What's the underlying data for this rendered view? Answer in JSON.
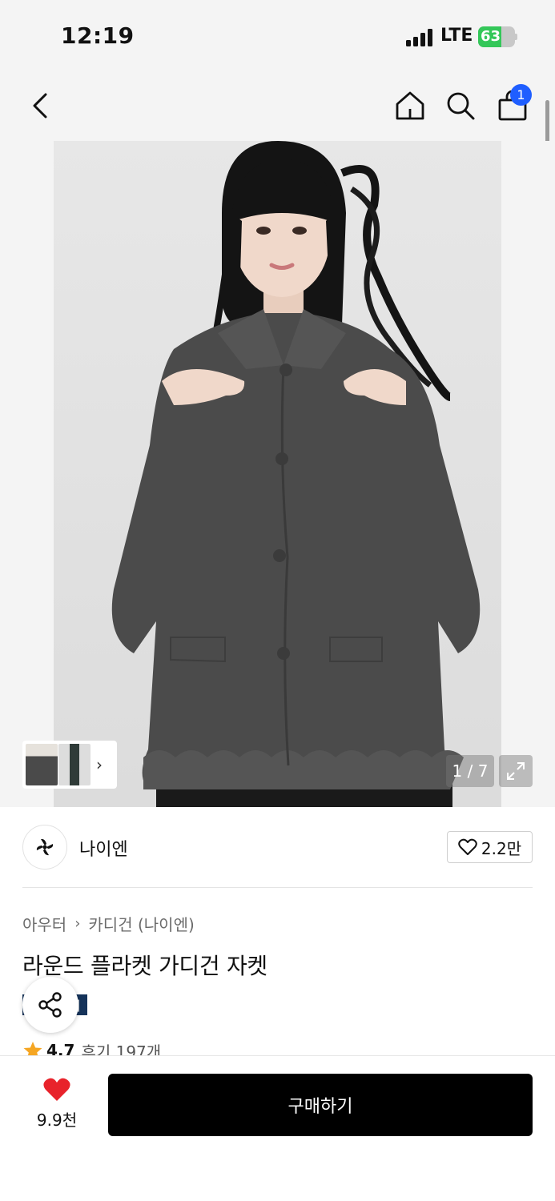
{
  "status_bar": {
    "time": "12:19",
    "network": "LTE",
    "battery": "63",
    "battery_level": 0.63
  },
  "nav": {
    "back_icon": "chevron-left-icon",
    "home_icon": "home-icon",
    "search_icon": "search-icon",
    "cart_icon": "shopping-bag-icon",
    "cart_count": "1"
  },
  "gallery": {
    "page_counter": "1 / 7",
    "expand_icon": "expand-icon",
    "thumb_arrow": "›"
  },
  "brand": {
    "name": "나이엔",
    "like_count": "2.2만"
  },
  "breadcrumb": {
    "category": "아우터",
    "separator": "›",
    "subcategory": "카디건 (나이엔)"
  },
  "product": {
    "title": "라운드 플라켓 가디건 자켓",
    "badge_partial": "이",
    "rating": "4.7",
    "reviews": "후기 197개"
  },
  "bottom_bar": {
    "wishlist_count": "9.9천",
    "buy_label": "구매하기"
  },
  "colors": {
    "accent_blue": "#1f5eff",
    "badge_navy": "#15335a",
    "heart_red": "#e8232b",
    "star_orange": "#f5a623",
    "battery_green": "#34c759"
  }
}
